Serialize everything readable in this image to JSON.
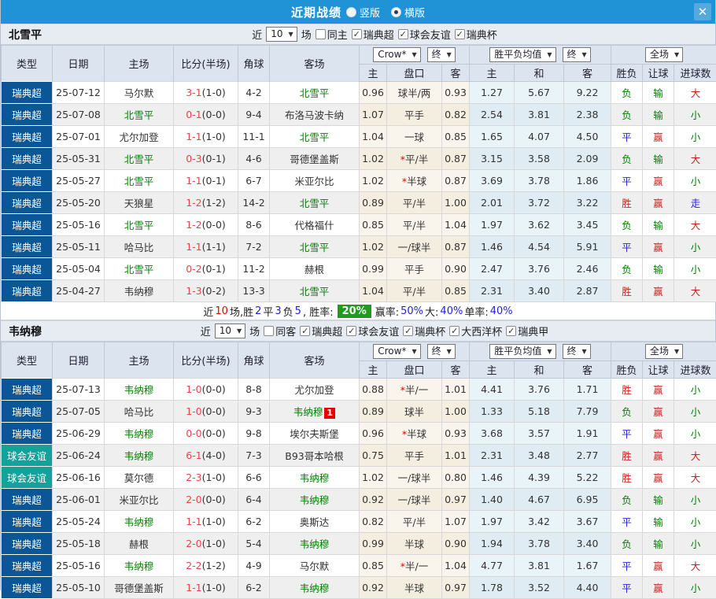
{
  "icons": {
    "chevron_down": "▼",
    "check": "✓",
    "close": "✕"
  },
  "colors": {
    "titlebar_bg": "#1f93d6",
    "league_bg": "#0a5696",
    "friendly_bg": "#14a19a",
    "focus_team_green": "#008000",
    "score_red": "#ef4444",
    "result_red": "#cc2222",
    "result_green": "#008000",
    "result_blue": "#2525d8",
    "winrate_badge_bg": "#1e9c1e",
    "badge_red": "#e60000"
  },
  "titlebar": {
    "title": "近期战绩",
    "radios": [
      {
        "label": "竖版",
        "selected": false
      },
      {
        "label": "横版",
        "selected": true
      }
    ]
  },
  "table_header": {
    "type": "类型",
    "date": "日期",
    "home": "主场",
    "score": "比分(半场)",
    "corner": "角球",
    "away": "客场",
    "group_odds_select": "Crow*",
    "group_odds_final": "终",
    "group_mean_select": "胜平负均值",
    "group_mean_final": "终",
    "group_result_select": "全场",
    "odds_home": "主",
    "handicap": "盘口",
    "odds_away": "客",
    "mean_home": "主",
    "mean_draw": "和",
    "mean_away": "客",
    "result_wdl": "胜负",
    "result_handicap": "让球",
    "result_goals": "进球数"
  },
  "sections": [
    {
      "team": "北雪平",
      "filter": {
        "prefix": "近",
        "count": "10",
        "suffix": "场",
        "venue": {
          "label": "同主",
          "checked": false
        },
        "competitions": [
          {
            "label": "瑞典超",
            "checked": true
          },
          {
            "label": "球会友谊",
            "checked": true
          },
          {
            "label": "瑞典杯",
            "checked": true
          }
        ]
      },
      "rows": [
        {
          "type": "瑞典超",
          "kind": "league",
          "date": "25-07-12",
          "home": "马尔默",
          "home_focus": false,
          "score": "3-1",
          "half": "(1-0)",
          "corner": "4-2",
          "away": "北雪平",
          "away_focus": true,
          "odds_home": "0.96",
          "star": false,
          "handicap": "球半/两",
          "odds_away": "0.93",
          "mean_home": "1.27",
          "mean_draw": "5.67",
          "mean_away": "9.22",
          "wdl": {
            "t": "负",
            "c": "g"
          },
          "hc": {
            "t": "输",
            "c": "g"
          },
          "gl": {
            "t": "大",
            "c": "r"
          }
        },
        {
          "type": "瑞典超",
          "kind": "league",
          "date": "25-07-08",
          "home": "北雪平",
          "home_focus": true,
          "score": "0-1",
          "half": "(0-0)",
          "corner": "9-4",
          "away": "布洛马波卡纳",
          "away_focus": false,
          "odds_home": "1.07",
          "star": false,
          "handicap": "平手",
          "odds_away": "0.82",
          "mean_home": "2.54",
          "mean_draw": "3.81",
          "mean_away": "2.38",
          "wdl": {
            "t": "负",
            "c": "g"
          },
          "hc": {
            "t": "输",
            "c": "g"
          },
          "gl": {
            "t": "小",
            "c": "g"
          }
        },
        {
          "type": "瑞典超",
          "kind": "league",
          "date": "25-07-01",
          "home": "尤尔加登",
          "home_focus": false,
          "score": "1-1",
          "half": "(1-0)",
          "corner": "11-1",
          "away": "北雪平",
          "away_focus": true,
          "odds_home": "1.04",
          "star": false,
          "handicap": "一球",
          "odds_away": "0.85",
          "mean_home": "1.65",
          "mean_draw": "4.07",
          "mean_away": "4.50",
          "wdl": {
            "t": "平",
            "c": "b"
          },
          "hc": {
            "t": "赢",
            "c": "r"
          },
          "gl": {
            "t": "小",
            "c": "g"
          }
        },
        {
          "type": "瑞典超",
          "kind": "league",
          "date": "25-05-31",
          "home": "北雪平",
          "home_focus": true,
          "score": "0-3",
          "half": "(0-1)",
          "corner": "4-6",
          "away": "哥德堡盖斯",
          "away_focus": false,
          "odds_home": "1.02",
          "star": true,
          "handicap": "平/半",
          "odds_away": "0.87",
          "mean_home": "3.15",
          "mean_draw": "3.58",
          "mean_away": "2.09",
          "wdl": {
            "t": "负",
            "c": "g"
          },
          "hc": {
            "t": "输",
            "c": "g"
          },
          "gl": {
            "t": "大",
            "c": "r"
          }
        },
        {
          "type": "瑞典超",
          "kind": "league",
          "date": "25-05-27",
          "home": "北雪平",
          "home_focus": true,
          "score": "1-1",
          "half": "(0-1)",
          "corner": "6-7",
          "away": "米亚尔比",
          "away_focus": false,
          "odds_home": "1.02",
          "star": true,
          "handicap": "半球",
          "odds_away": "0.87",
          "mean_home": "3.69",
          "mean_draw": "3.78",
          "mean_away": "1.86",
          "wdl": {
            "t": "平",
            "c": "b"
          },
          "hc": {
            "t": "赢",
            "c": "r"
          },
          "gl": {
            "t": "小",
            "c": "g"
          }
        },
        {
          "type": "瑞典超",
          "kind": "league",
          "date": "25-05-20",
          "home": "天狼星",
          "home_focus": false,
          "score": "1-2",
          "half": "(1-2)",
          "corner": "14-2",
          "away": "北雪平",
          "away_focus": true,
          "odds_home": "0.89",
          "star": false,
          "handicap": "平/半",
          "odds_away": "1.00",
          "mean_home": "2.01",
          "mean_draw": "3.72",
          "mean_away": "3.22",
          "wdl": {
            "t": "胜",
            "c": "r"
          },
          "hc": {
            "t": "赢",
            "c": "r"
          },
          "gl": {
            "t": "走",
            "c": "b"
          }
        },
        {
          "type": "瑞典超",
          "kind": "league",
          "date": "25-05-16",
          "home": "北雪平",
          "home_focus": true,
          "score": "1-2",
          "half": "(0-0)",
          "corner": "8-6",
          "away": "代格福什",
          "away_focus": false,
          "odds_home": "0.85",
          "star": false,
          "handicap": "平/半",
          "odds_away": "1.04",
          "mean_home": "1.97",
          "mean_draw": "3.62",
          "mean_away": "3.45",
          "wdl": {
            "t": "负",
            "c": "g"
          },
          "hc": {
            "t": "输",
            "c": "g"
          },
          "gl": {
            "t": "大",
            "c": "r"
          }
        },
        {
          "type": "瑞典超",
          "kind": "league",
          "date": "25-05-11",
          "home": "哈马比",
          "home_focus": false,
          "score": "1-1",
          "half": "(1-1)",
          "corner": "7-2",
          "away": "北雪平",
          "away_focus": true,
          "odds_home": "1.02",
          "star": false,
          "handicap": "一/球半",
          "odds_away": "0.87",
          "mean_home": "1.46",
          "mean_draw": "4.54",
          "mean_away": "5.91",
          "wdl": {
            "t": "平",
            "c": "b"
          },
          "hc": {
            "t": "赢",
            "c": "r"
          },
          "gl": {
            "t": "小",
            "c": "g"
          }
        },
        {
          "type": "瑞典超",
          "kind": "league",
          "date": "25-05-04",
          "home": "北雪平",
          "home_focus": true,
          "score": "0-2",
          "half": "(0-1)",
          "corner": "11-2",
          "away": "赫根",
          "away_focus": false,
          "odds_home": "0.99",
          "star": false,
          "handicap": "平手",
          "odds_away": "0.90",
          "mean_home": "2.47",
          "mean_draw": "3.76",
          "mean_away": "2.46",
          "wdl": {
            "t": "负",
            "c": "g"
          },
          "hc": {
            "t": "输",
            "c": "g"
          },
          "gl": {
            "t": "小",
            "c": "g"
          }
        },
        {
          "type": "瑞典超",
          "kind": "league",
          "date": "25-04-27",
          "home": "韦纳穆",
          "home_focus": false,
          "score": "1-3",
          "half": "(0-2)",
          "corner": "13-3",
          "away": "北雪平",
          "away_focus": true,
          "odds_home": "1.04",
          "star": false,
          "handicap": "平/半",
          "odds_away": "0.85",
          "mean_home": "2.31",
          "mean_draw": "3.40",
          "mean_away": "2.87",
          "wdl": {
            "t": "胜",
            "c": "r"
          },
          "hc": {
            "t": "赢",
            "c": "r"
          },
          "gl": {
            "t": "大",
            "c": "r"
          }
        }
      ],
      "summary": {
        "segments": [
          {
            "text": "近",
            "c": "k"
          },
          {
            "text": "10",
            "c": "r"
          },
          {
            "text": "场,胜",
            "c": "k"
          },
          {
            "text": "2",
            "c": "b"
          },
          {
            "text": "平",
            "c": "k"
          },
          {
            "text": "3",
            "c": "b"
          },
          {
            "text": "负",
            "c": "k"
          },
          {
            "text": "5",
            "c": "b"
          },
          {
            "text": ", 胜率:",
            "c": "k"
          },
          {
            "text": "20%",
            "c": "badge"
          },
          {
            "text": "赢率:",
            "c": "k"
          },
          {
            "text": "50%",
            "c": "b"
          },
          {
            "text": " 大:",
            "c": "k"
          },
          {
            "text": "40%",
            "c": "b"
          },
          {
            "text": " 单率:",
            "c": "k"
          },
          {
            "text": "40%",
            "c": "b"
          }
        ]
      }
    },
    {
      "team": "韦纳穆",
      "filter": {
        "prefix": "近",
        "count": "10",
        "suffix": "场",
        "venue": {
          "label": "同客",
          "checked": false
        },
        "competitions": [
          {
            "label": "瑞典超",
            "checked": true
          },
          {
            "label": "球会友谊",
            "checked": true
          },
          {
            "label": "瑞典杯",
            "checked": true
          },
          {
            "label": "大西洋杯",
            "checked": true
          },
          {
            "label": "瑞典甲",
            "checked": true
          }
        ]
      },
      "rows": [
        {
          "type": "瑞典超",
          "kind": "league",
          "date": "25-07-13",
          "home": "韦纳穆",
          "home_focus": true,
          "score": "1-0",
          "half": "(0-0)",
          "corner": "8-8",
          "away": "尤尔加登",
          "away_focus": false,
          "odds_home": "0.88",
          "star": true,
          "handicap": "半/一",
          "odds_away": "1.01",
          "mean_home": "4.41",
          "mean_draw": "3.76",
          "mean_away": "1.71",
          "wdl": {
            "t": "胜",
            "c": "r"
          },
          "hc": {
            "t": "赢",
            "c": "r"
          },
          "gl": {
            "t": "小",
            "c": "g"
          }
        },
        {
          "type": "瑞典超",
          "kind": "league",
          "date": "25-07-05",
          "home": "哈马比",
          "home_focus": false,
          "score": "1-0",
          "half": "(0-0)",
          "corner": "9-3",
          "away": "韦纳穆",
          "away_focus": true,
          "away_badge": "1",
          "odds_home": "0.89",
          "star": false,
          "handicap": "球半",
          "odds_away": "1.00",
          "mean_home": "1.33",
          "mean_draw": "5.18",
          "mean_away": "7.79",
          "wdl": {
            "t": "负",
            "c": "g"
          },
          "hc": {
            "t": "赢",
            "c": "r"
          },
          "gl": {
            "t": "小",
            "c": "g"
          }
        },
        {
          "type": "瑞典超",
          "kind": "league",
          "date": "25-06-29",
          "home": "韦纳穆",
          "home_focus": true,
          "score": "0-0",
          "half": "(0-0)",
          "corner": "9-8",
          "away": "埃尔夫斯堡",
          "away_focus": false,
          "odds_home": "0.96",
          "star": true,
          "handicap": "半球",
          "odds_away": "0.93",
          "mean_home": "3.68",
          "mean_draw": "3.57",
          "mean_away": "1.91",
          "wdl": {
            "t": "平",
            "c": "b"
          },
          "hc": {
            "t": "赢",
            "c": "r"
          },
          "gl": {
            "t": "小",
            "c": "g"
          }
        },
        {
          "type": "球会友谊",
          "kind": "friendly",
          "date": "25-06-24",
          "home": "韦纳穆",
          "home_focus": true,
          "score": "6-1",
          "half": "(4-0)",
          "corner": "7-3",
          "away": "B93哥本哈根",
          "away_focus": false,
          "odds_home": "0.75",
          "star": false,
          "handicap": "平手",
          "odds_away": "1.01",
          "mean_home": "2.31",
          "mean_draw": "3.48",
          "mean_away": "2.77",
          "wdl": {
            "t": "胜",
            "c": "r"
          },
          "hc": {
            "t": "赢",
            "c": "r"
          },
          "gl": {
            "t": "大",
            "c": "r"
          }
        },
        {
          "type": "球会友谊",
          "kind": "friendly",
          "date": "25-06-16",
          "home": "莫尔德",
          "home_focus": false,
          "score": "2-3",
          "half": "(1-0)",
          "corner": "6-6",
          "away": "韦纳穆",
          "away_focus": true,
          "odds_home": "1.02",
          "star": false,
          "handicap": "一/球半",
          "odds_away": "0.80",
          "mean_home": "1.46",
          "mean_draw": "4.39",
          "mean_away": "5.22",
          "wdl": {
            "t": "胜",
            "c": "r"
          },
          "hc": {
            "t": "赢",
            "c": "r"
          },
          "gl": {
            "t": "大",
            "c": "r"
          }
        },
        {
          "type": "瑞典超",
          "kind": "league",
          "date": "25-06-01",
          "home": "米亚尔比",
          "home_focus": false,
          "score": "2-0",
          "half": "(0-0)",
          "corner": "6-4",
          "away": "韦纳穆",
          "away_focus": true,
          "odds_home": "0.92",
          "star": false,
          "handicap": "一/球半",
          "odds_away": "0.97",
          "mean_home": "1.40",
          "mean_draw": "4.67",
          "mean_away": "6.95",
          "wdl": {
            "t": "负",
            "c": "g"
          },
          "hc": {
            "t": "输",
            "c": "g"
          },
          "gl": {
            "t": "小",
            "c": "g"
          }
        },
        {
          "type": "瑞典超",
          "kind": "league",
          "date": "25-05-24",
          "home": "韦纳穆",
          "home_focus": true,
          "score": "1-1",
          "half": "(1-0)",
          "corner": "6-2",
          "away": "奥斯达",
          "away_focus": false,
          "odds_home": "0.82",
          "star": false,
          "handicap": "平/半",
          "odds_away": "1.07",
          "mean_home": "1.97",
          "mean_draw": "3.42",
          "mean_away": "3.67",
          "wdl": {
            "t": "平",
            "c": "b"
          },
          "hc": {
            "t": "输",
            "c": "g"
          },
          "gl": {
            "t": "小",
            "c": "g"
          }
        },
        {
          "type": "瑞典超",
          "kind": "league",
          "date": "25-05-18",
          "home": "赫根",
          "home_focus": false,
          "score": "2-0",
          "half": "(1-0)",
          "corner": "5-4",
          "away": "韦纳穆",
          "away_focus": true,
          "odds_home": "0.99",
          "star": false,
          "handicap": "半球",
          "odds_away": "0.90",
          "mean_home": "1.94",
          "mean_draw": "3.78",
          "mean_away": "3.40",
          "wdl": {
            "t": "负",
            "c": "g"
          },
          "hc": {
            "t": "输",
            "c": "g"
          },
          "gl": {
            "t": "小",
            "c": "g"
          }
        },
        {
          "type": "瑞典超",
          "kind": "league",
          "date": "25-05-16",
          "home": "韦纳穆",
          "home_focus": true,
          "score": "2-2",
          "half": "(1-2)",
          "corner": "4-9",
          "away": "马尔默",
          "away_focus": false,
          "odds_home": "0.85",
          "star": true,
          "handicap": "半/一",
          "odds_away": "1.04",
          "mean_home": "4.77",
          "mean_draw": "3.81",
          "mean_away": "1.67",
          "wdl": {
            "t": "平",
            "c": "b"
          },
          "hc": {
            "t": "赢",
            "c": "r"
          },
          "gl": {
            "t": "大",
            "c": "r"
          }
        },
        {
          "type": "瑞典超",
          "kind": "league",
          "date": "25-05-10",
          "home": "哥德堡盖斯",
          "home_focus": false,
          "score": "1-1",
          "half": "(1-0)",
          "corner": "6-2",
          "away": "韦纳穆",
          "away_focus": true,
          "odds_home": "0.92",
          "star": false,
          "handicap": "半球",
          "odds_away": "0.97",
          "mean_home": "1.78",
          "mean_draw": "3.52",
          "mean_away": "4.40",
          "wdl": {
            "t": "平",
            "c": "b"
          },
          "hc": {
            "t": "赢",
            "c": "r"
          },
          "gl": {
            "t": "小",
            "c": "g"
          }
        }
      ],
      "summary": null
    }
  ]
}
